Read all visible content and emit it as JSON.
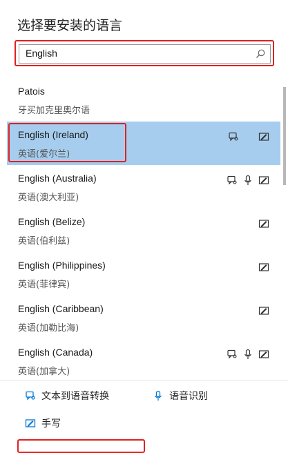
{
  "dialog": {
    "title": "选择要安装的语言",
    "search": {
      "value": "English",
      "icon": "search-icon"
    }
  },
  "languages": [
    {
      "en": "Patois",
      "zh": "牙买加克里奥尔语",
      "features": []
    },
    {
      "en": "English (Ireland)",
      "zh": "英语(爱尔兰)",
      "features": [
        "tts",
        "handwriting"
      ],
      "selected": true
    },
    {
      "en": "English (Australia)",
      "zh": "英语(澳大利亚)",
      "features": [
        "tts",
        "speech",
        "handwriting"
      ]
    },
    {
      "en": "English (Belize)",
      "zh": "英语(伯利兹)",
      "features": [
        "handwriting"
      ]
    },
    {
      "en": "English (Philippines)",
      "zh": "英语(菲律宾)",
      "features": [
        "handwriting"
      ]
    },
    {
      "en": "English (Caribbean)",
      "zh": "英语(加勒比海)",
      "features": [
        "handwriting"
      ]
    },
    {
      "en": "English (Canada)",
      "zh": "英语(加拿大)",
      "features": [
        "tts",
        "speech",
        "handwriting"
      ]
    }
  ],
  "legend": {
    "tts": "文本到语音转换",
    "speech": "语音识别",
    "handwriting": "手写"
  },
  "colors": {
    "accent": "#0078d7",
    "selected_bg": "#a6cdee",
    "highlight_box": "#e02020"
  }
}
